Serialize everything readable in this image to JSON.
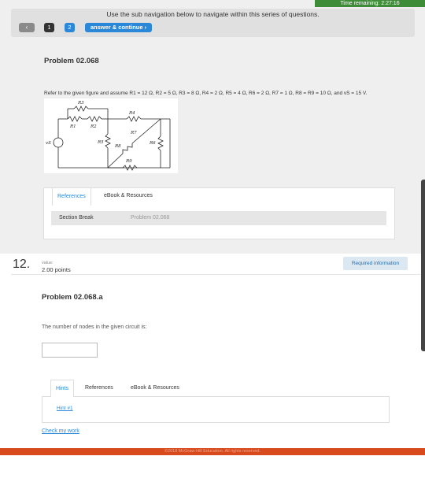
{
  "timer": {
    "text": "Time remaining: 2:27:16"
  },
  "subnav": {
    "instructions": "Use the sub navigation below to navigate within this series of questions.",
    "back_glyph": "‹",
    "pages": [
      "1",
      "2"
    ],
    "continue_label": "answer & continue ›"
  },
  "problem1": {
    "title": "Problem 02.068",
    "text": "Refer to the given figure and assume R1 = 12 Ω, R2 = 5 Ω, R3 = 8 Ω, R4 = 2 Ω, R5 = 4 Ω, R6 = 2 Ω, R7 = 1 Ω, R8 = R9 = 10 Ω, and vS = 15 V.",
    "circuit_labels": {
      "r1": "R1",
      "r2": "R2",
      "r3": "R3",
      "r4": "R4",
      "r5": "R5",
      "r6": "R6",
      "r7": "R7",
      "r8": "R8",
      "r9": "R9",
      "vs": "vS"
    },
    "tabs": [
      "References",
      "eBook & Resources"
    ],
    "section_label": "Section Break",
    "section_value": "Problem 02.068"
  },
  "question": {
    "number": "12.",
    "value_label": "value:",
    "points": "2.00 points",
    "required": "Required information",
    "title": "Problem 02.068.a",
    "text": "The number of nodes in the given circuit is:",
    "answer_value": "",
    "tabs": [
      "Hints",
      "References",
      "eBook & Resources"
    ],
    "hint": "Hint #1",
    "check": "Check my work"
  },
  "footer": {
    "text": "©2018 McGraw-Hill Education. All rights reserved."
  },
  "colors": {
    "accent": "#2b88d8",
    "timer": "#3f8c38",
    "footer": "#d64a1e"
  }
}
